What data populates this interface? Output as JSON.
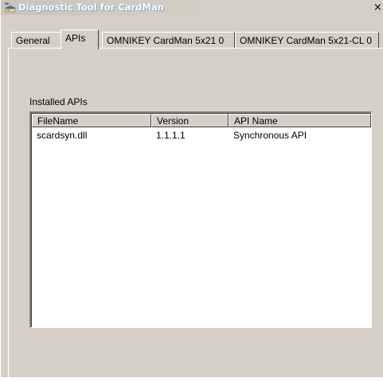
{
  "window": {
    "title": "Diagnostic Tool for CardMan",
    "app_icon": "cardman-app-icon",
    "close_glyph": "×",
    "close_icon": "close-icon"
  },
  "tabs": [
    {
      "label": "General",
      "active": false
    },
    {
      "label": "APIs",
      "active": true
    },
    {
      "label": "OMNIKEY CardMan 5x21 0",
      "active": false
    },
    {
      "label": "OMNIKEY CardMan 5x21-CL 0",
      "active": false
    }
  ],
  "apis_panel": {
    "section_label": "Installed APIs",
    "columns": [
      "FileName",
      "Version",
      "API Name"
    ],
    "rows": [
      {
        "filename": "scardsyn.dll",
        "version": "1.1.1.1",
        "api_name": "Synchronous API"
      }
    ]
  },
  "colors": {
    "dialog_face": "#d4d0c8",
    "title_text": "#ffffff",
    "list_background": "#ffffff"
  }
}
